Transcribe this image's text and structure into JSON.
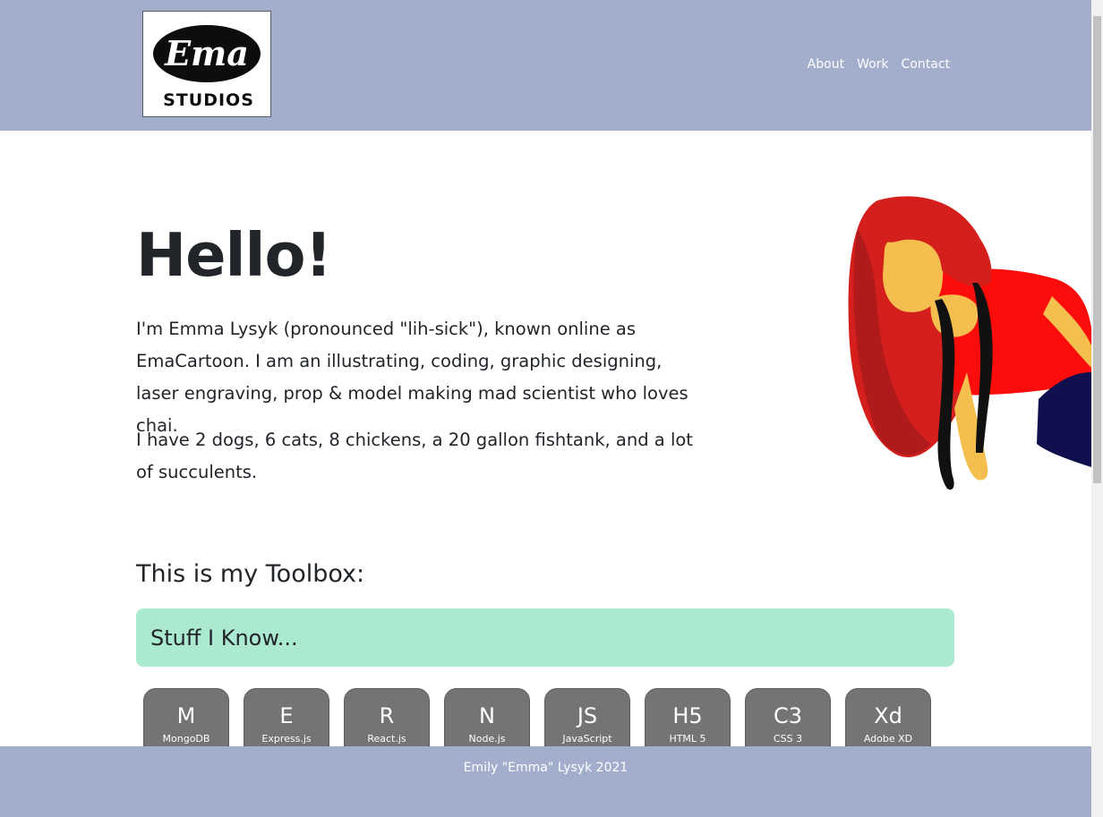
{
  "header": {
    "logo": {
      "text_top": "Ema",
      "text_bottom": "STUDIOS"
    },
    "nav": [
      "About",
      "Work",
      "Contact"
    ]
  },
  "hero": {
    "title": "Hello!",
    "paragraph1": "I'm Emma Lysyk (pronounced \"lih-sick\"), known online as EmaCartoon. I am an illustrating, coding, graphic designing, laser engraving, prop & model making mad scientist who loves chai.",
    "paragraph2": "I have 2 dogs, 6 cats, 8 chickens, a 20 gallon fishtank, and a lot of succulents."
  },
  "toolbox": {
    "title": "This is my Toolbox:",
    "section_label": "Stuff I Know...",
    "skills": [
      {
        "abbr": "M",
        "name": "MongoDB"
      },
      {
        "abbr": "E",
        "name": "Express.js"
      },
      {
        "abbr": "R",
        "name": "React.js"
      },
      {
        "abbr": "N",
        "name": "Node.js"
      },
      {
        "abbr": "JS",
        "name": "JavaScript"
      },
      {
        "abbr": "H5",
        "name": "HTML 5"
      },
      {
        "abbr": "C3",
        "name": "CSS 3"
      },
      {
        "abbr": "Xd",
        "name": "Adobe XD"
      }
    ]
  },
  "footer": {
    "text": "Emily \"Emma\" Lysyk 2021"
  },
  "colors": {
    "header_bg": "#a3aecd",
    "section_bar_bg": "#abe9d1",
    "skill_card_bg": "#747474",
    "hair": "#d51f1c",
    "shirt": "#fc0d0b",
    "skin": "#f4bf4f"
  }
}
